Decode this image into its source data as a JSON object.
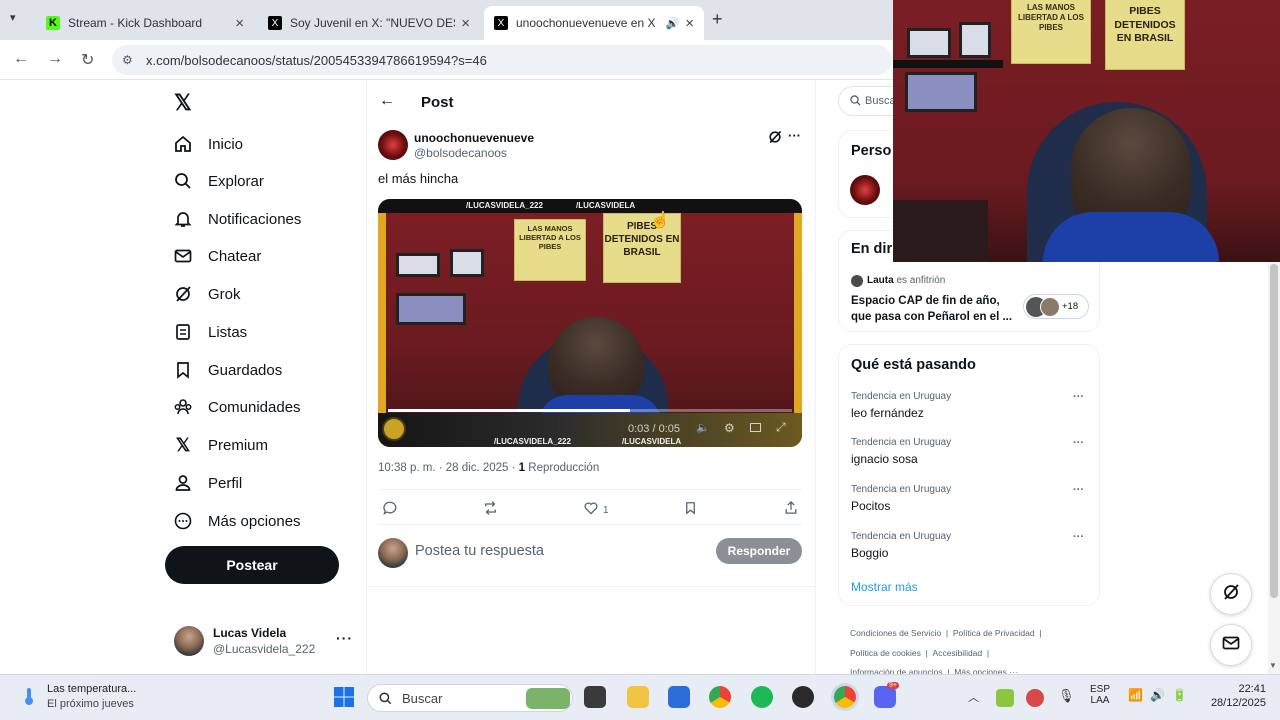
{
  "browser": {
    "tabs": [
      {
        "title": "Stream - Kick Dashboard"
      },
      {
        "title": "Soy Juvenil en X: \"NUEVO DEST"
      },
      {
        "title": "unoochonuevenueve en X"
      }
    ],
    "url": "x.com/bolsodecanoos/status/2005453394786619594?s=46"
  },
  "sidebar": {
    "items": [
      {
        "label": "Inicio"
      },
      {
        "label": "Explorar"
      },
      {
        "label": "Notificaciones"
      },
      {
        "label": "Chatear"
      },
      {
        "label": "Grok"
      },
      {
        "label": "Listas"
      },
      {
        "label": "Guardados"
      },
      {
        "label": "Comunidades"
      },
      {
        "label": "Premium"
      },
      {
        "label": "Perfil"
      },
      {
        "label": "Más opciones"
      }
    ],
    "post_label": "Postear",
    "account": {
      "name": "Lucas Videla",
      "handle": "@Lucasvidela_222"
    }
  },
  "post": {
    "header": "Post",
    "author_name": "unoochonuevenueve",
    "author_handle": "@bolsodecanoos",
    "text": "el más hincha",
    "video": {
      "overlay_top_1": "/LUCASVIDELA_222",
      "overlay_top_2": "/LUCASVIDELA",
      "overlay_bottom_1": "/LUCASVIDELA_222",
      "overlay_bottom_2": "/LUCASVIDELA",
      "time": "0:03 / 0:05",
      "progress": 0.6,
      "wall_sign_1": "LAS MANOS LIBERTAD A LOS PIBES",
      "wall_sign_2": "PIBES DETENIDOS EN BRASIL"
    },
    "time": "10:38 p. m. · 28 dic. 2025 ·",
    "plays_count": "1",
    "plays_label": "Reproducción",
    "likes": "1",
    "reply_placeholder": "Postea tu respuesta",
    "reply_button": "Responder"
  },
  "right": {
    "search_placeholder": "Busca",
    "persons_title": "Perso",
    "live_title": "En dir",
    "space": {
      "host": "Lauta",
      "host_suffix": "es anfitrión",
      "title": "Espacio CAP de fin de año, que pasa con Peñarol en el ...",
      "extra": "+18"
    },
    "trends_title": "Qué está pasando",
    "trends": [
      {
        "category": "Tendencia en Uruguay",
        "name": "leo fernández"
      },
      {
        "category": "Tendencia en Uruguay",
        "name": "ignacio sosa"
      },
      {
        "category": "Tendencia en Uruguay",
        "name": "Pocitos"
      },
      {
        "category": "Tendencia en Uruguay",
        "name": "Boggio"
      }
    ],
    "show_more": "Mostrar más",
    "footer": {
      "terms": "Condiciones de Servicio",
      "privacy": "Política de Privacidad",
      "cookies": "Política de cookies",
      "accessibility": "Accesibilidad",
      "ads": "Información de anuncios",
      "more": "Más opciones ···"
    }
  },
  "webcam": {
    "sign_1": "LAS MANOS LIBERTAD A LOS PIBES",
    "sign_2": "PIBES DETENIDOS EN BRASIL"
  },
  "taskbar": {
    "weather_title": "Las temperatura...",
    "weather_sub": "El próximo jueves",
    "search": "Buscar",
    "lang_1": "ESP",
    "lang_2": "LAA",
    "time": "22:41",
    "date": "28/12/2025",
    "discord_badge": "9+"
  },
  "colors": {
    "accent": "#1d9bf0",
    "dark": "#0f1419",
    "wall": "#7a1e24"
  }
}
